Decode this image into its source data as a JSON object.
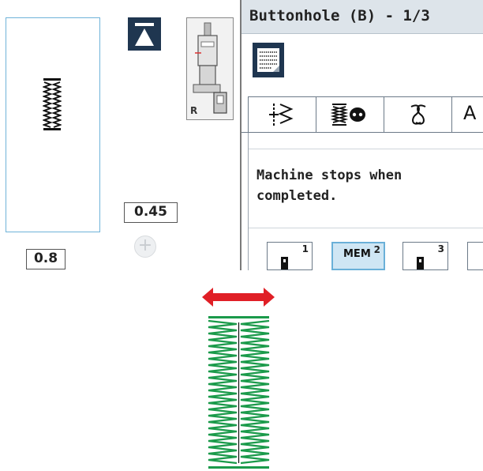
{
  "left_panel": {
    "width_value": "0.8",
    "length_value": "0.45",
    "presser_foot_letter": "R"
  },
  "header": {
    "title": "Buttonhole (B) - 1/3"
  },
  "tabs": [
    {
      "icon": "straight-zigzag-stitch-icon",
      "active": false
    },
    {
      "icon": "buttonhole-stitch-icon",
      "active": true
    },
    {
      "icon": "decorative-stitch-icon",
      "active": false
    },
    {
      "label": "A",
      "active": false
    }
  ],
  "message": "Machine stops when completed.",
  "stitch_buttons": [
    {
      "superscript": "1",
      "label": ""
    },
    {
      "superscript": "2",
      "label": "MEM"
    },
    {
      "superscript": "3",
      "label": ""
    }
  ],
  "colors": {
    "accent_blue": "#6ab0d8",
    "dark_navy": "#1f3650",
    "arrow_red": "#e01f26",
    "stitch_green": "#1a9a4a"
  }
}
